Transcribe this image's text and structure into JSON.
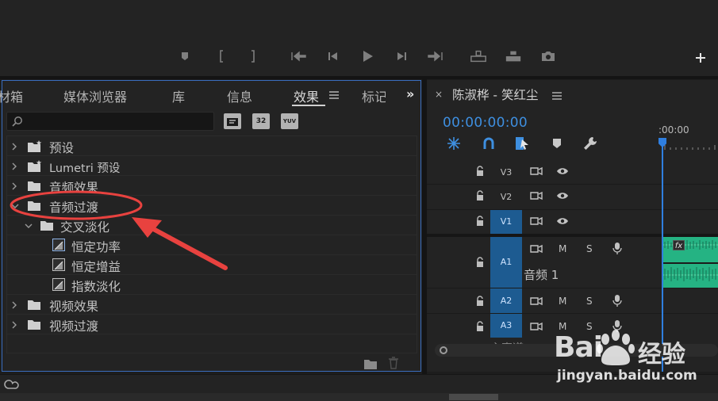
{
  "monitor": {
    "controls": [
      "add-marker-icon",
      "mark-in-icon",
      "mark-out-icon",
      "go-to-in-icon",
      "step-back-icon",
      "play-icon",
      "step-forward-icon",
      "go-to-out-icon",
      "lift-icon",
      "extract-icon",
      "export-frame-icon"
    ],
    "add_button": "+"
  },
  "effects_panel": {
    "tabs": [
      "材箱",
      "媒体浏览器",
      "库",
      "信息",
      "效果",
      "标记"
    ],
    "active_tab": "效果",
    "overflow": "»",
    "search": {
      "value": "",
      "placeholder": ""
    },
    "filters": [
      {
        "icon": "accelerated-effects-icon",
        "label": ""
      },
      {
        "icon": "32bit-color-icon",
        "label": "32"
      },
      {
        "icon": "yuv-effects-icon",
        "label": "YUV"
      }
    ],
    "items": [
      {
        "label": "预设",
        "level": 0,
        "expanded": false,
        "icon": "preset-folder-icon"
      },
      {
        "label": "Lumetri 预设",
        "level": 0,
        "expanded": false,
        "icon": "preset-folder-icon"
      },
      {
        "label": "音频效果",
        "level": 0,
        "expanded": false,
        "icon": "folder-icon"
      },
      {
        "label": "音频过渡",
        "level": 0,
        "expanded": true,
        "icon": "folder-icon"
      },
      {
        "label": "交叉淡化",
        "level": 1,
        "expanded": true,
        "icon": "folder-icon"
      },
      {
        "label": "恒定功率",
        "level": 2,
        "icon": "transition-icon",
        "selected": true
      },
      {
        "label": "恒定增益",
        "level": 2,
        "icon": "transition-icon"
      },
      {
        "label": "指数淡化",
        "level": 2,
        "icon": "transition-icon"
      },
      {
        "label": "视频效果",
        "level": 0,
        "expanded": false,
        "icon": "folder-icon"
      },
      {
        "label": "视频过渡",
        "level": 0,
        "expanded": false,
        "icon": "folder-icon"
      }
    ]
  },
  "timeline": {
    "close": "×",
    "title": "陈淑桦 - 笑红尘",
    "timecode": "00:00:00:00",
    "ruler_time": ":00:00",
    "tools": [
      "snap-icon",
      "linked-selection-icon",
      "add-marker-icon",
      "wrench-icon"
    ],
    "video_tracks": [
      "V3",
      "V2",
      "V1"
    ],
    "audio_tracks": [
      "A1",
      "A2",
      "A3"
    ],
    "track_buttons": {
      "mute": "M",
      "solo": "S"
    },
    "audio_clip_label": "音频 1",
    "fx_badge": "fx",
    "partial_track_label": "主声道"
  },
  "watermark": {
    "brand": "Bai",
    "brand_cn": "经验",
    "url": "jingyan.baidu.com"
  },
  "colors": {
    "accent": "#3e8fe0",
    "annotation": "#e8423f",
    "clip": "#25b383",
    "panel_border": "#3a6ebf"
  }
}
